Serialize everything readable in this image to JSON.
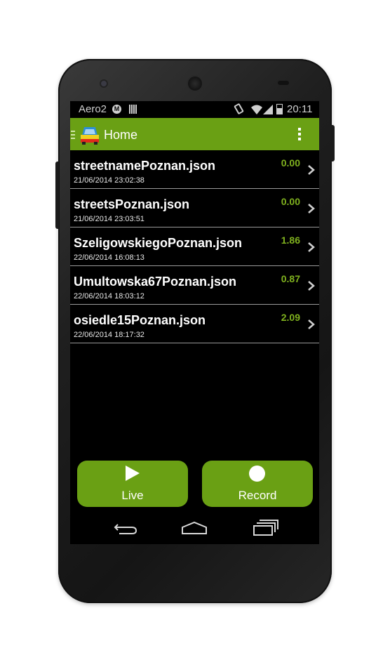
{
  "status_bar": {
    "carrier": "Aero2",
    "time": "20:11"
  },
  "action_bar": {
    "title": "Home",
    "color": "#6aa014"
  },
  "files": [
    {
      "name": "streetnamePoznan.json",
      "date": "21/06/2014 23:02:38",
      "value": "0.00"
    },
    {
      "name": "streetsPoznan.json",
      "date": "21/06/2014 23:03:51",
      "value": "0.00"
    },
    {
      "name": "SzeligowskiegoPoznan.json",
      "date": "22/06/2014 16:08:13",
      "value": "1.86"
    },
    {
      "name": "Umultowska67Poznan.json",
      "date": "22/06/2014 18:03:12",
      "value": "0.87"
    },
    {
      "name": "osiedle15Poznan.json",
      "date": "22/06/2014 18:17:32",
      "value": "2.09"
    }
  ],
  "buttons": {
    "live_label": "Live",
    "record_label": "Record"
  },
  "icons": {
    "app": "car-icon",
    "overflow": "overflow-menu-icon",
    "drawer": "drawer-icon",
    "row_chevron": "chevron-right-icon",
    "live": "play-icon",
    "record": "record-icon",
    "nav": [
      "back-icon",
      "home-icon",
      "recent-apps-icon"
    ]
  }
}
